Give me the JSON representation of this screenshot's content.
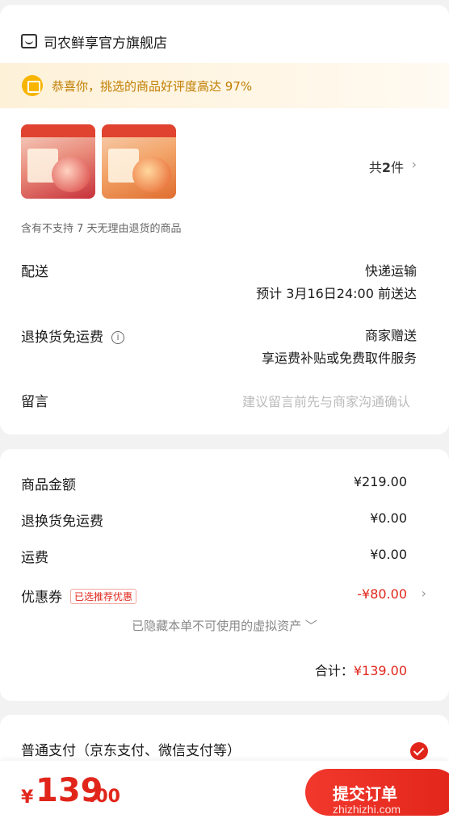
{
  "store": {
    "name": "司农鲜享官方旗舰店"
  },
  "banner": {
    "text": "恭喜你，挑选的商品好评度高达 97%"
  },
  "products": {
    "count_prefix": "共",
    "count": "2",
    "count_suffix": "件",
    "notice": "含有不支持 7 天无理由退货的商品"
  },
  "delivery": {
    "label": "配送",
    "method": "快递运输",
    "eta": "预计 3月16日24:00 前送达"
  },
  "return_shipping": {
    "label": "退换货免运费",
    "info_icon": "i",
    "value_line1": "商家赠送",
    "value_line2": "享运费补贴或免费取件服务"
  },
  "message": {
    "label": "留言",
    "placeholder": "建议留言前先与商家沟通确认"
  },
  "summary": {
    "goods_amount_label": "商品金额",
    "goods_amount": "¥219.00",
    "return_fee_label": "退换货免运费",
    "return_fee": "¥0.00",
    "shipping_label": "运费",
    "shipping": "¥0.00",
    "coupon_label": "优惠券",
    "coupon_tag": "已选推荐优惠",
    "coupon_value": "-¥80.00",
    "hidden_note": "已隐藏本单不可使用的虚拟资产 ﹀",
    "total_label": "合计：",
    "total_value": "¥139.00"
  },
  "payment": {
    "label": "普通支付（京东支付、微信支付等）"
  },
  "bottom": {
    "currency": "¥",
    "price_int": "139",
    "price_dec": ".00",
    "submit_label": "提交订单",
    "watermark": "zhizhizhi.com"
  },
  "colors": {
    "accent": "#e1251b",
    "banner_text": "#c07d00",
    "banner_bg": "#fdf1d8"
  }
}
